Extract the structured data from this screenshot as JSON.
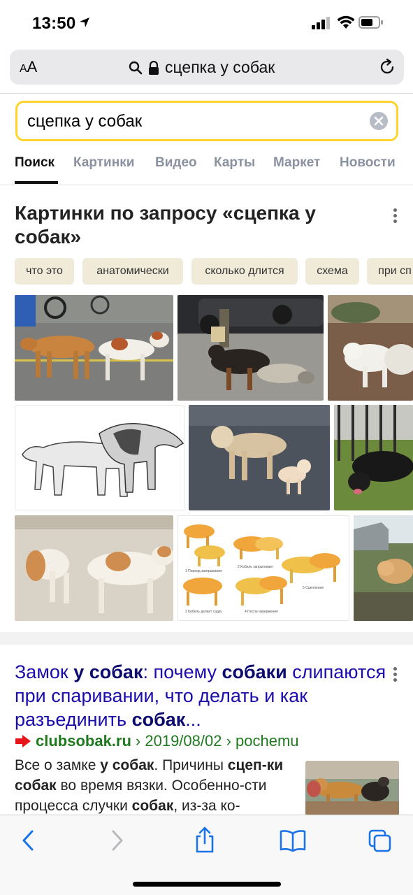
{
  "status_bar": {
    "time": "13:50"
  },
  "url_bar": {
    "aa_label_small": "A",
    "aa_label_large": "A",
    "address": "сцепка у собак"
  },
  "search": {
    "query": "сцепка у собак"
  },
  "tabs": [
    {
      "label": "Поиск",
      "active": true
    },
    {
      "label": "Картинки",
      "active": false
    },
    {
      "label": "Видео",
      "active": false
    },
    {
      "label": "Карты",
      "active": false
    },
    {
      "label": "Маркет",
      "active": false
    },
    {
      "label": "Новости",
      "active": false
    }
  ],
  "images_block": {
    "heading": "Картинки по запросу «сцепка у собак»",
    "chips": [
      "что это",
      "анатомически",
      "сколько длится",
      "схема",
      "при сп"
    ],
    "scheme_tile_captions": [
      "1 Период заигрывания",
      "2 Кобель запрыгивает",
      "3 Кобель делает садку",
      "4 После извержения",
      "5 Сцепление"
    ]
  },
  "result": {
    "title_parts": [
      {
        "text": "Замок ",
        "bold": false
      },
      {
        "text": "у собак",
        "bold": true
      },
      {
        "text": ": почему ",
        "bold": false
      },
      {
        "text": "собаки",
        "bold": true
      },
      {
        "text": " слипаются при спаривании, что делать и как разъединить ",
        "bold": false
      },
      {
        "text": "собак",
        "bold": true
      },
      {
        "text": "...",
        "bold": false
      }
    ],
    "domain": "clubsobak.ru",
    "path": "› 2019/08/02 › pochemu",
    "snippet_parts": [
      {
        "text": "Все о замке ",
        "bold": false
      },
      {
        "text": "у собак",
        "bold": true
      },
      {
        "text": ". Причины ",
        "bold": false
      },
      {
        "text": "сцеп-ки собак",
        "bold": true
      },
      {
        "text": " во время вязки. Особенно-сти процесса случки ",
        "bold": false
      },
      {
        "text": "собак",
        "bold": true
      },
      {
        "text": ", из-за ко-",
        "bold": false
      }
    ]
  },
  "colors": {
    "accent_yellow": "#fed42b",
    "link_blue": "#1a0dab",
    "url_green": "#1f7a1f",
    "chip_bg": "#f0ebd8"
  },
  "icons": [
    "location-arrow-icon",
    "cellular-signal-icon",
    "wifi-icon",
    "battery-icon",
    "search-icon",
    "lock-icon",
    "reload-icon",
    "clear-icon",
    "more-icon",
    "back-icon",
    "forward-icon",
    "share-icon",
    "bookmarks-icon",
    "tabs-icon"
  ]
}
